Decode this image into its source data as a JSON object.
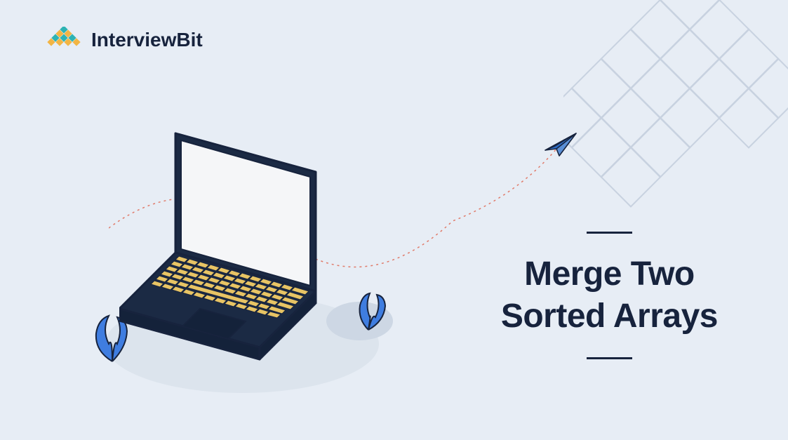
{
  "brand": {
    "name_prefix": "Interview",
    "name_suffix": "Bit"
  },
  "title": {
    "line1": "Merge Two",
    "line2": "Sorted Arrays"
  }
}
